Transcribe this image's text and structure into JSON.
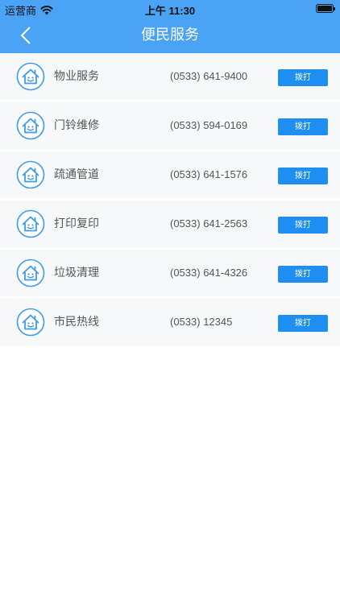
{
  "status_bar": {
    "carrier": "运营商",
    "time": "上午 11:30",
    "wifi_icon": "wifi-icon",
    "battery_icon": "battery-icon"
  },
  "nav": {
    "title": "便民服务",
    "back_icon": "chevron-left-icon"
  },
  "colors": {
    "nav_background": "#4aa3f5",
    "call_button": "#1f8ef2",
    "row_background": "#f7f8fa"
  },
  "services": [
    {
      "name": "物业服务",
      "phone": "(0533) 641-9400",
      "action": "拨打",
      "icon": "house-smiley-icon"
    },
    {
      "name": "门铃维修",
      "phone": "(0533) 594-0169",
      "action": "拨打",
      "icon": "house-smiley-icon"
    },
    {
      "name": "疏通管道",
      "phone": "(0533) 641-1576",
      "action": "拨打",
      "icon": "house-smiley-icon"
    },
    {
      "name": "打印复印",
      "phone": "(0533) 641-2563",
      "action": "拨打",
      "icon": "house-smiley-icon"
    },
    {
      "name": "垃圾清理",
      "phone": "(0533) 641-4326",
      "action": "拨打",
      "icon": "house-smiley-icon"
    },
    {
      "name": "市民热线",
      "phone": "(0533) 12345",
      "action": "拨打",
      "icon": "house-smiley-icon"
    }
  ]
}
